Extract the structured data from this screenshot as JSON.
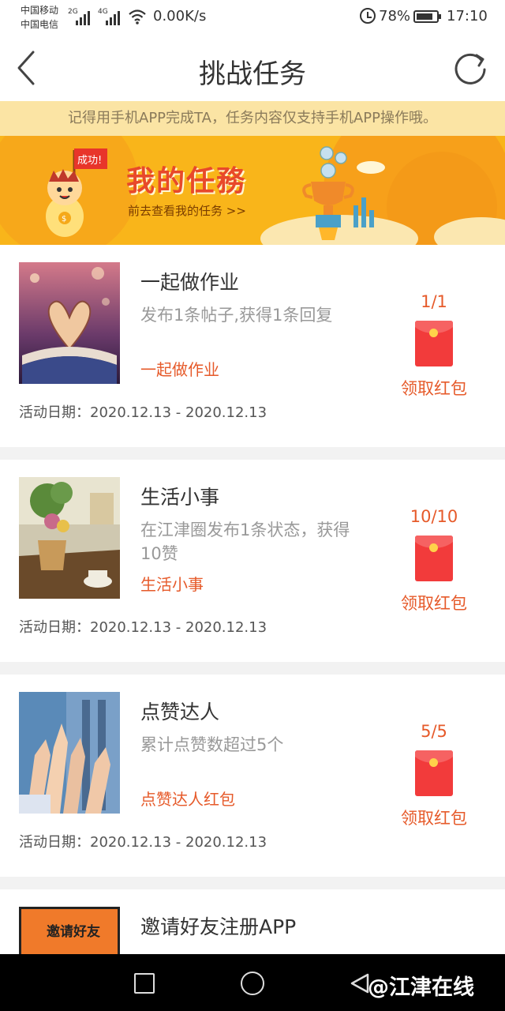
{
  "status_bar": {
    "carrier1": "中国移动",
    "carrier2": "中国电信",
    "net1": "2G",
    "net2": "4G",
    "speed": "0.00K/s",
    "battery": "78%",
    "time": "17:10"
  },
  "header": {
    "title": "挑战任务",
    "back_icon": "chevron-left-icon",
    "refresh_icon": "refresh-icon"
  },
  "notice": "记得用手机APP完成TA，任务内容仅支持手机APP操作哦。",
  "banner": {
    "badge": "成功!",
    "title": "我的任務",
    "subtitle": "前去查看我的任务 >>"
  },
  "tasks": [
    {
      "title": "一起做作业",
      "desc": "发布1条帖子,获得1条回复",
      "link": "一起做作业",
      "date": "活动日期：2020.12.13 - 2020.12.13",
      "progress": "1/1",
      "claim": "领取红包"
    },
    {
      "title": "生活小事",
      "desc": "在江津圈发布1条状态，获得10赞",
      "link": "生活小事",
      "date": "活动日期：2020.12.13 - 2020.12.13",
      "progress": "10/10",
      "claim": "领取红包"
    },
    {
      "title": "点赞达人",
      "desc": "累计点赞数超过5个",
      "link": "点赞达人红包",
      "date": "活动日期：2020.12.13 - 2020.12.13",
      "progress": "5/5",
      "claim": "领取红包"
    },
    {
      "title": "邀请好友注册APP",
      "img_text": "邀请好友"
    }
  ],
  "nav": {
    "watermark": "@江津在线"
  },
  "colors": {
    "accent": "#e65a2a",
    "banner_bg": "#f9b51a",
    "notice_bg": "#fbe4a4",
    "envelope": "#f23b3b"
  }
}
